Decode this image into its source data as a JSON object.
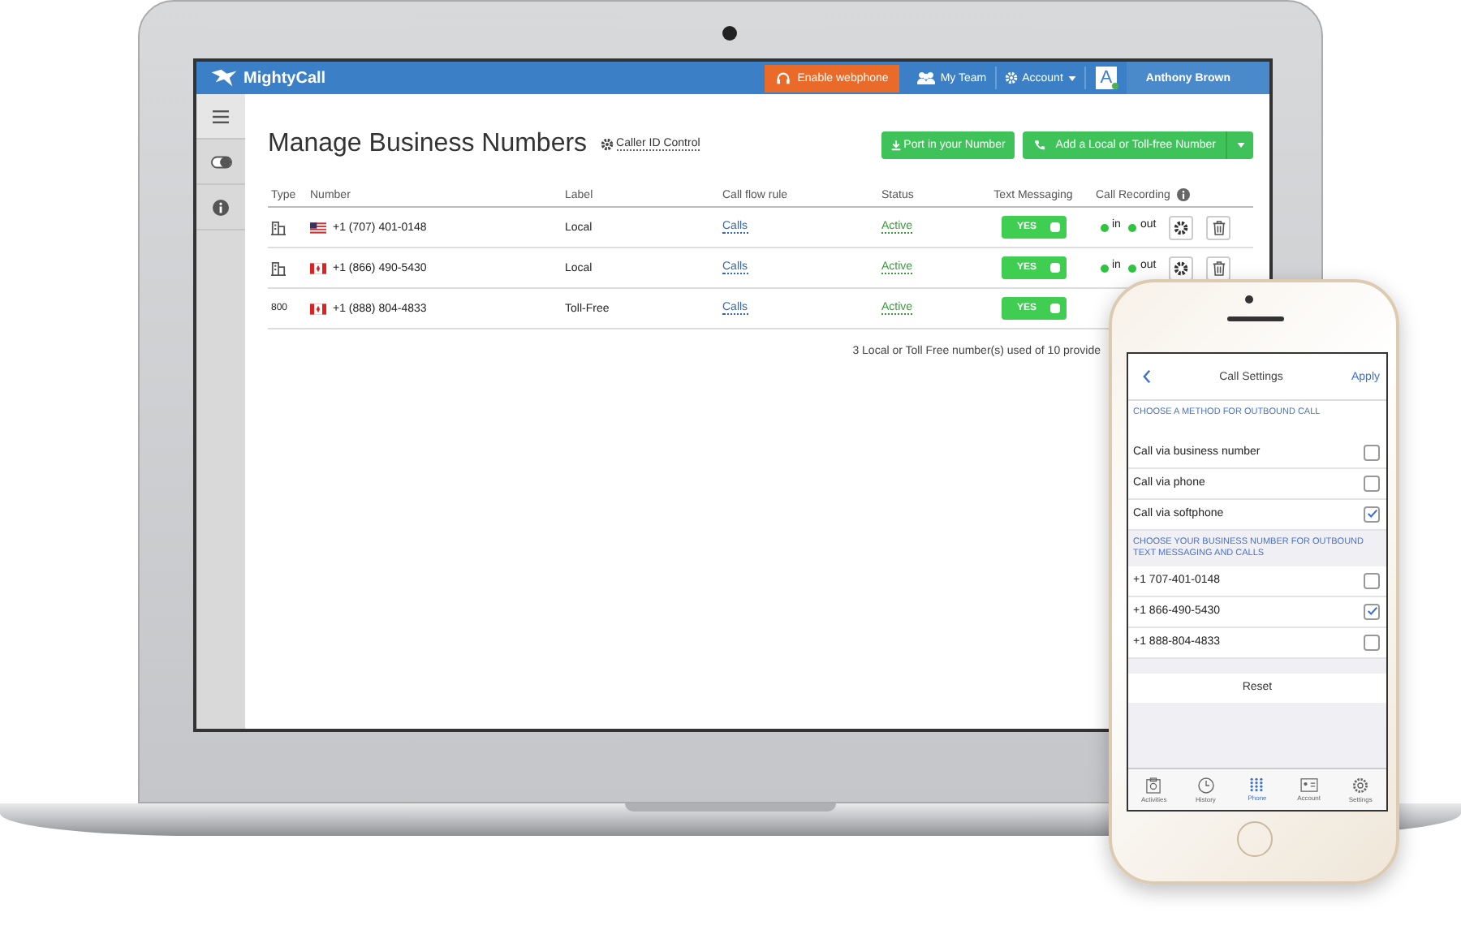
{
  "topbar": {
    "logo": "MightyCall",
    "webphone_button": "Enable webphone",
    "team_link": "My Team",
    "account_menu": "Account",
    "avatar_letter": "A",
    "avatar_online": true,
    "user_name": "Anthony Brown"
  },
  "sidebar": {
    "items": [
      {
        "kind": "menu",
        "selected": true
      },
      {
        "kind": "toggle",
        "selected": false
      },
      {
        "kind": "info",
        "selected": false
      }
    ]
  },
  "page": {
    "title": "Manage Business Numbers",
    "caller_id_link": "Caller ID Control",
    "port_button": "Port in your Number",
    "add_button": "Add a Local or Toll-free Number"
  },
  "table": {
    "columns": [
      "Type",
      "Number",
      "Label",
      "Call flow rule",
      "Status",
      "Text Messaging",
      "Call Recording"
    ],
    "rows": [
      {
        "type": {
          "kind": "building"
        },
        "flag": {
          "kind": "us"
        },
        "number": "+1 (707) 401-0148",
        "label": "Local",
        "rule": "Calls",
        "status": "Active",
        "sms": {
          "label": "YES",
          "on": true
        },
        "recording": {
          "in": "in",
          "out": "out"
        }
      },
      {
        "type": {
          "kind": "building"
        },
        "flag": {
          "kind": "ca"
        },
        "number": "+1 (866) 490-5430",
        "label": "Local",
        "rule": "Calls",
        "status": "Active",
        "sms": {
          "label": "YES",
          "on": true
        },
        "recording": {
          "in": "in",
          "out": "out"
        }
      },
      {
        "type": {
          "kind": "text",
          "text": "800"
        },
        "flag": {
          "kind": "ca"
        },
        "number": "+1 (888) 804-4833",
        "label": "Toll-Free",
        "rule": "Calls",
        "status": "Active",
        "sms": {
          "label": "YES",
          "on": true
        },
        "recording": null
      }
    ],
    "footer": "3 Local or Toll Free number(s) used of 10 provide"
  },
  "phone": {
    "title": "Call Settings",
    "apply": "Apply",
    "sections": [
      {
        "header": "CHOOSE A METHOD FOR OUTBOUND CALL",
        "options": [
          {
            "label": "Call via business number",
            "checked": false
          },
          {
            "label": "Call via phone",
            "checked": false
          },
          {
            "label": "Call via softphone",
            "checked": true
          }
        ]
      },
      {
        "header": "CHOOSE YOUR BUSINESS NUMBER FOR OUTBOUND TEXT MESSAGING AND CALLS",
        "options": [
          {
            "label": "+1 707-401-0148",
            "checked": false
          },
          {
            "label": "+1 866-490-5430",
            "checked": true
          },
          {
            "label": "+1 888-804-4833",
            "checked": false
          }
        ]
      }
    ],
    "reset": "Reset",
    "tabs": [
      {
        "kind": "activities",
        "label": "Activities",
        "selected": false
      },
      {
        "kind": "history",
        "label": "History",
        "selected": false
      },
      {
        "kind": "phone",
        "label": "Phone",
        "selected": true
      },
      {
        "kind": "account",
        "label": "Account",
        "selected": false
      },
      {
        "kind": "settings",
        "label": "Settings",
        "selected": false
      }
    ]
  }
}
